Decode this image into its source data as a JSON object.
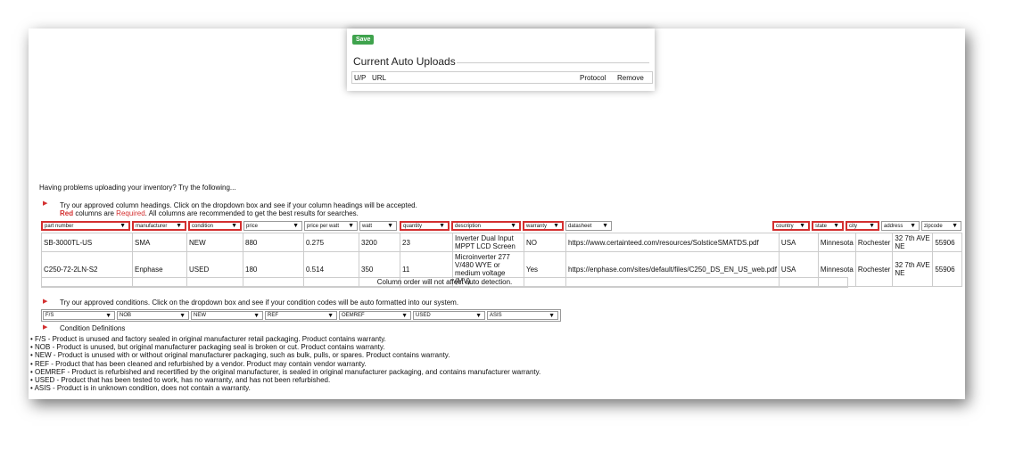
{
  "top": {
    "save_label": "Save",
    "title": "Current Auto Uploads",
    "columns": [
      "U/P",
      "URL",
      "Protocol",
      "Remove"
    ]
  },
  "help": {
    "title": "Having problems uploading your inventory? Try the following...",
    "hint1": "Try our approved column headings. Click on the dropdown box and see if your column headings will be accepted.",
    "red_word": "Red",
    "columns_are": "columns are",
    "required": "Required",
    "rec": ". All columns are recommended to get the best results for searches.",
    "hint2": "Try our approved conditions. Click on the dropdown box and see if your condition codes will be auto formatted into our system.",
    "cond_defs_title": "Condition Definitions"
  },
  "headers": [
    {
      "label": "part number",
      "required": true
    },
    {
      "label": "manufacturer",
      "required": true
    },
    {
      "label": "condition",
      "required": true
    },
    {
      "label": "price",
      "required": false
    },
    {
      "label": "price per watt",
      "required": false
    },
    {
      "label": "watt",
      "required": false
    },
    {
      "label": "quantity",
      "required": true
    },
    {
      "label": "description",
      "required": true
    },
    {
      "label": "warranty",
      "required": true
    },
    {
      "label": "datasheet",
      "required": false
    },
    {
      "label": "country",
      "required": true
    },
    {
      "label": "state",
      "required": true
    },
    {
      "label": "city",
      "required": true
    },
    {
      "label": "address",
      "required": false
    },
    {
      "label": "zipcode",
      "required": false
    }
  ],
  "rows": [
    [
      "SB-3000TL-US",
      "SMA",
      "NEW",
      "880",
      "0.275",
      "3200",
      "23",
      "Inverter Dual Input MPPT LCD Screen",
      "NO",
      "https://www.certainteed.com/resources/SolsticeSMATDS.pdf",
      "USA",
      "Minnesota",
      "Rochester",
      "32 7th AVE NE",
      "55906"
    ],
    [
      "C250-72-2LN-S2",
      "Enphase",
      "USED",
      "180",
      "0.514",
      "350",
      "11",
      "Microinverter 277 V/480 WYE or medium voltage (MV)",
      "Yes",
      "https://enphase.com/sites/default/files/C250_DS_EN_US_web.pdf",
      "USA",
      "Minnesota",
      "Rochester",
      "32 7th AVE NE",
      "55906"
    ]
  ],
  "note": "Column order will not affect auto detection.",
  "conditions": [
    "F/S",
    "NOB",
    "NEW",
    "REF",
    "OEMREF",
    "USED",
    "ASIS"
  ],
  "definitions": [
    "F/S - Product is unused and factory sealed in original manufacturer retail packaging. Product contains warranty.",
    "NOB - Product is unused, but original manufacturer packaging seal is broken or cut. Product contains warranty.",
    "NEW - Product is unused with or without original manufacturer packaging, such as bulk, pulls, or spares. Product contains warranty.",
    "REF - Product that has been cleaned and refurbished by a vendor. Product may contain vendor warranty.",
    "OEMREF - Product is refurbished and recertified by the original manufacturer, is sealed in original manufacturer packaging, and contains manufacturer warranty.",
    "USED - Product that has been tested to work, has no warranty, and has not been refurbished.",
    "ASIS - Product is in unknown condition, does not contain a warranty."
  ],
  "colors": {
    "required_red": "#d32f2f",
    "save_green": "#3fa34d"
  }
}
